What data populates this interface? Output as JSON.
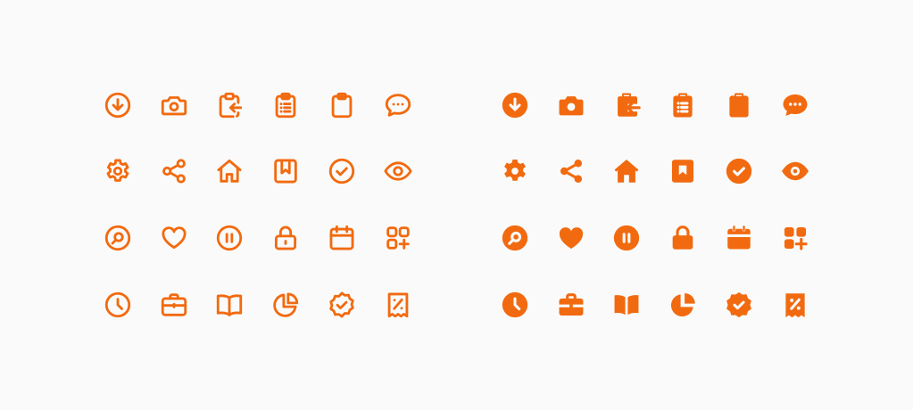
{
  "colors": {
    "accent": "#f26a0f",
    "background": "#fafafa"
  },
  "icon_sets": [
    {
      "style": "outline",
      "icons": [
        "arrow-down-circle-icon",
        "camera-icon",
        "clipboard-import-icon",
        "clipboard-list-icon",
        "clipboard-icon",
        "chat-bubble-icon",
        "gear-icon",
        "share-icon",
        "home-icon",
        "bookmark-icon",
        "check-circle-icon",
        "eye-icon",
        "search-circle-icon",
        "heart-icon",
        "pause-circle-icon",
        "lock-icon",
        "calendar-icon",
        "apps-add-icon",
        "clock-icon",
        "briefcase-icon",
        "book-open-icon",
        "pie-chart-icon",
        "badge-check-icon",
        "receipt-percent-icon"
      ]
    },
    {
      "style": "filled",
      "icons": [
        "arrow-down-circle-icon",
        "camera-icon",
        "clipboard-import-icon",
        "clipboard-list-icon",
        "clipboard-icon",
        "chat-bubble-icon",
        "gear-icon",
        "share-icon",
        "home-icon",
        "bookmark-icon",
        "check-circle-icon",
        "eye-icon",
        "search-circle-icon",
        "heart-icon",
        "pause-circle-icon",
        "lock-icon",
        "calendar-icon",
        "apps-add-icon",
        "clock-icon",
        "briefcase-icon",
        "book-open-icon",
        "pie-chart-icon",
        "badge-check-icon",
        "receipt-percent-icon"
      ]
    }
  ]
}
